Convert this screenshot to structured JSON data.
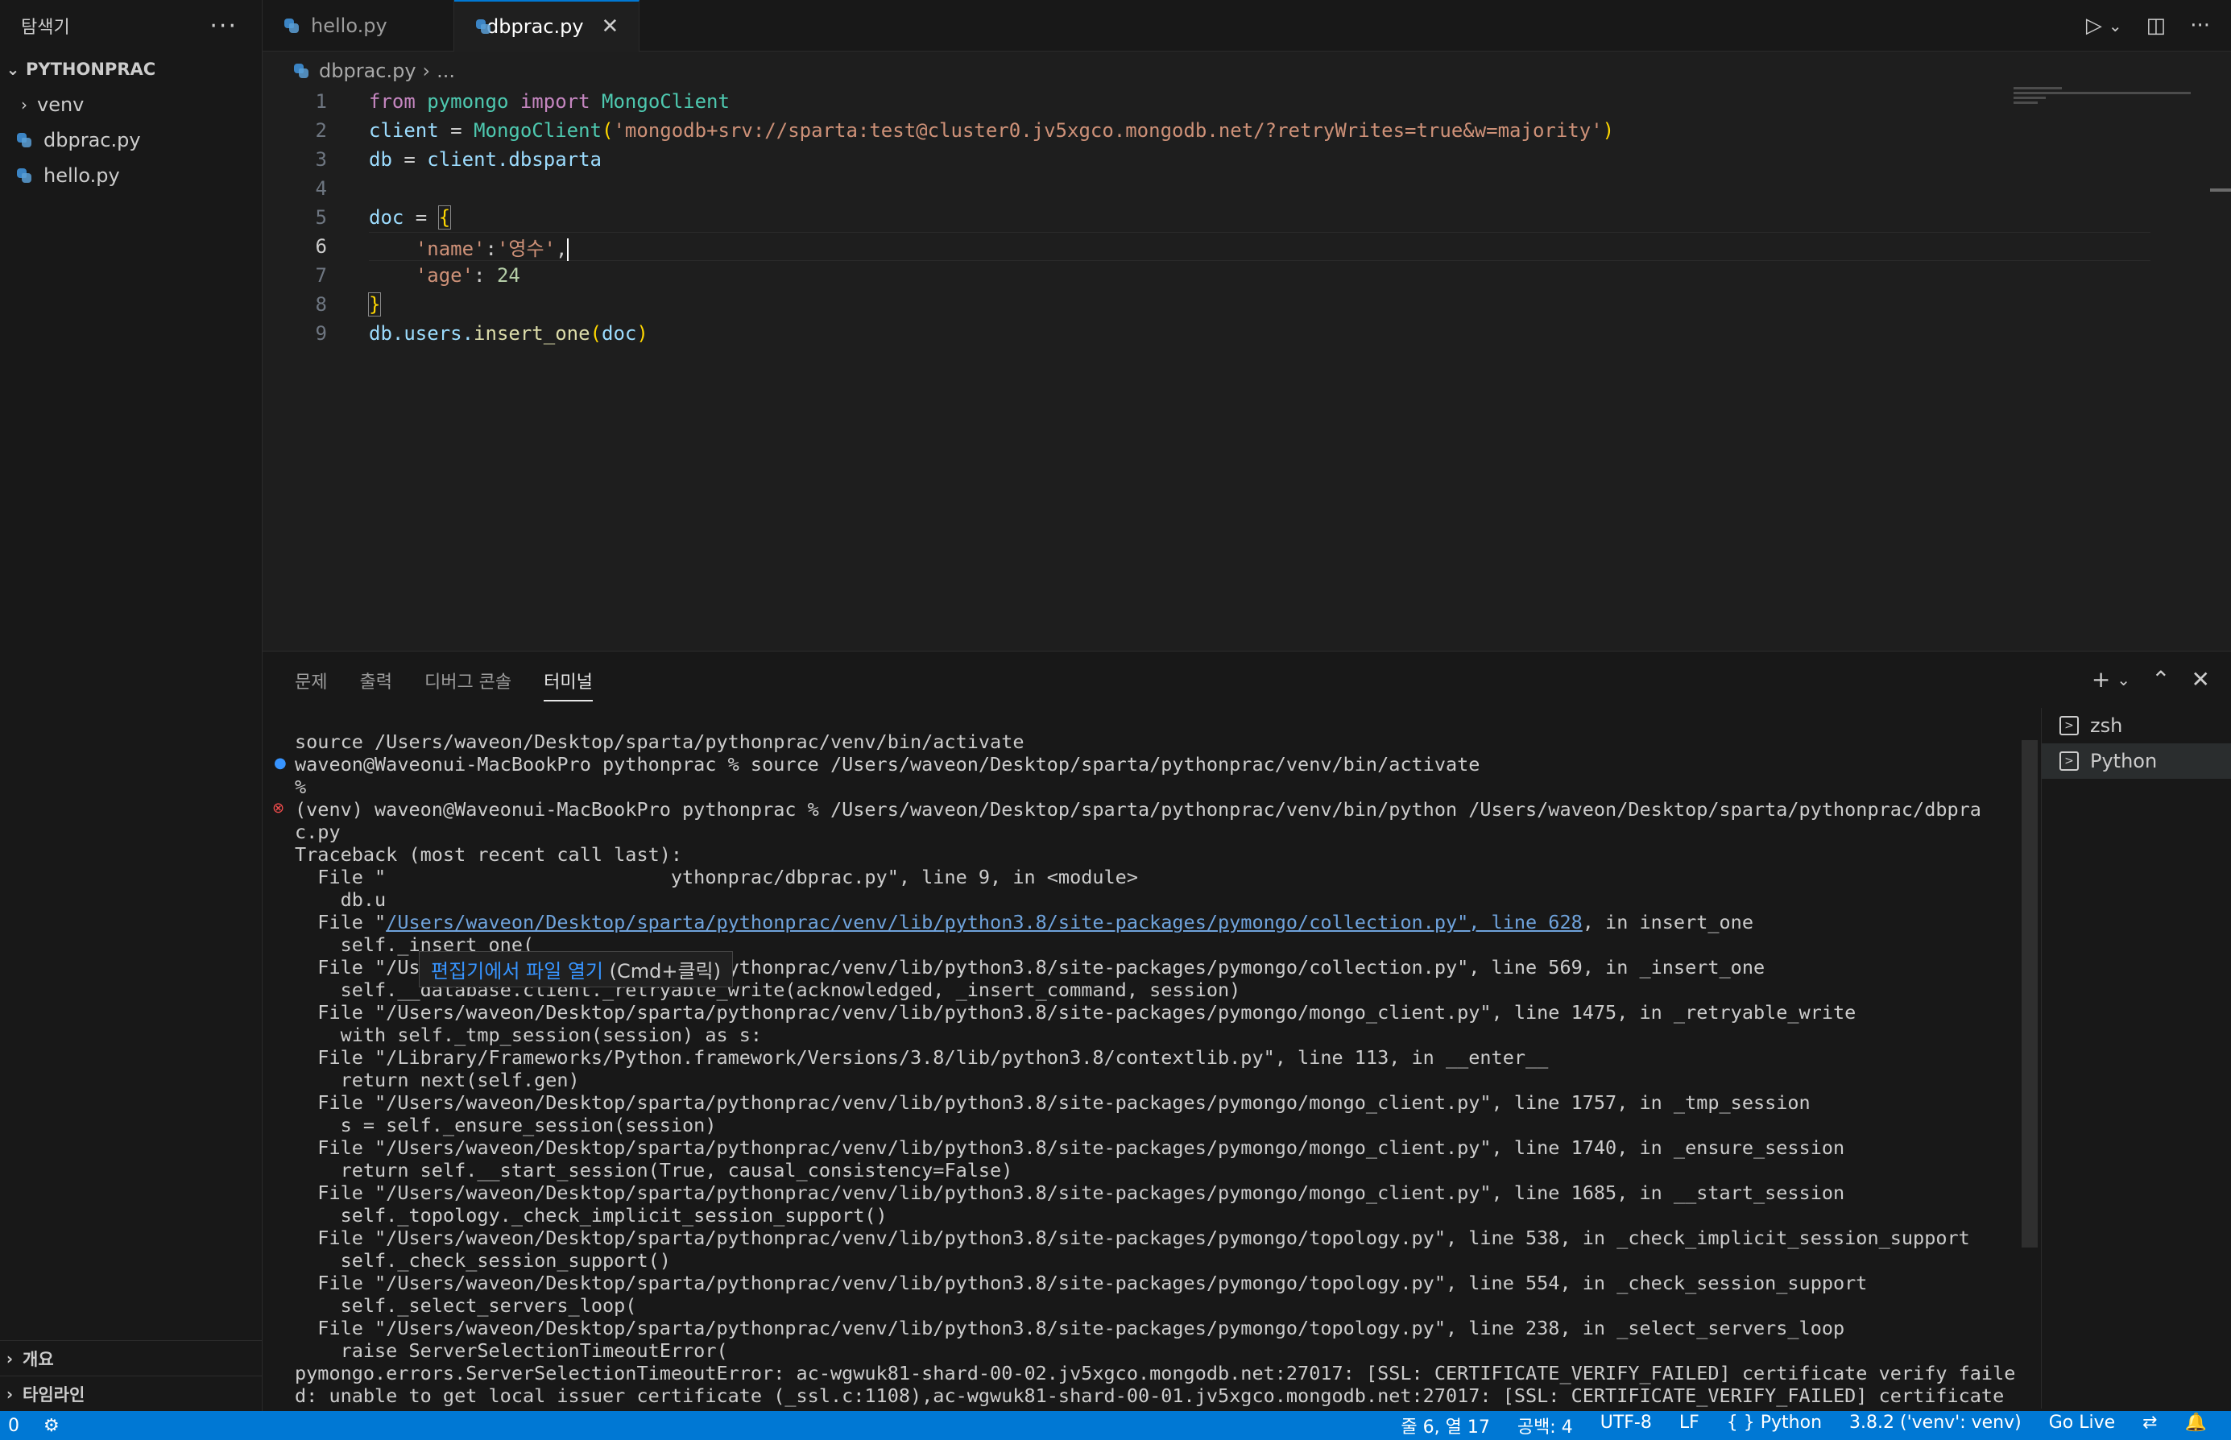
{
  "sidebar": {
    "title": "탐색기",
    "more": "···",
    "project": "PYTHONPRAC",
    "items": [
      {
        "label": "venv",
        "type": "folder"
      },
      {
        "label": "dbprac.py",
        "type": "file"
      },
      {
        "label": "hello.py",
        "type": "file"
      }
    ],
    "outline": "개요",
    "timeline": "타임라인"
  },
  "tabs": [
    {
      "label": "hello.py"
    },
    {
      "label": "dbprac.py",
      "close": "✕"
    }
  ],
  "tab_actions": {
    "run": "▷",
    "run_menu": "⌄",
    "split": "◫",
    "more": "···"
  },
  "breadcrumb": {
    "file": "dbprac.py",
    "sep": "›",
    "more": "..."
  },
  "editor": {
    "lines": [
      {
        "n": "1"
      },
      {
        "n": "2"
      },
      {
        "n": "3"
      },
      {
        "n": "4"
      },
      {
        "n": "5"
      },
      {
        "n": "6"
      },
      {
        "n": "7"
      },
      {
        "n": "8"
      },
      {
        "n": "9"
      }
    ],
    "code": {
      "l1_from": "from",
      "l1_mod": "pymongo",
      "l1_import": "import",
      "l1_cls": "MongoClient",
      "l2_var": "client",
      "l2_eq": " = ",
      "l2_cls": "MongoClient",
      "l2_open": "(",
      "l2_str": "'mongodb+srv://sparta:test@cluster0.jv5xgco.mongodb.net/?retryWrites=true&w=majority'",
      "l2_close": ")",
      "l3_var": "db",
      "l3_eq": " = ",
      "l3_rest": "client.dbsparta",
      "l5_var": "doc",
      "l5_eq": " = ",
      "l5_brace": "{",
      "l6_key": "'name'",
      "l6_colon": ":",
      "l6_val": "'영수'",
      "l6_comma": ",",
      "l7_key": "'age'",
      "l7_colon": ": ",
      "l7_val": "24",
      "l8_brace": "}",
      "l9_obj": "db.users.",
      "l9_fn": "insert_one",
      "l9_open": "(",
      "l9_arg": "doc",
      "l9_close": ")"
    }
  },
  "panel": {
    "tabs": [
      "문제",
      "출력",
      "디버그 콘솔",
      "터미널"
    ],
    "actions": {
      "add": "+",
      "add_menu": "⌄",
      "maximize": "⌃",
      "close": "✕"
    },
    "terminals": [
      {
        "label": "zsh",
        "icon": ">"
      },
      {
        "label": "Python",
        "icon": ">"
      }
    ],
    "tooltip": {
      "link": "편집기에서 파일 열기",
      "hint": " (Cmd+클릭)"
    },
    "lines": [
      "source /Users/waveon/Desktop/sparta/pythonprac/venv/bin/activate",
      "waveon@Waveonui-MacBookPro pythonprac % source /Users/waveon/Desktop/sparta/pythonprac/venv/bin/activate",
      "%",
      "(venv) waveon@Waveonui-MacBookPro pythonprac % /Users/waveon/Desktop/sparta/pythonprac/venv/bin/python /Users/waveon/Desktop/sparta/pythonprac/dbpra",
      "c.py",
      "Traceback (most recent call last):",
      "  File \"                         ythonprac/dbprac.py\", line 9, in <module>",
      "    db.u",
      "  File \"/Users/waveon/Desktop/sparta/pythonprac/venv/lib/python3.8/site-packages/pymongo/collection.py\", line 628, in insert_one",
      "    self._insert_one(",
      "  File \"/Users/waveon/Desktop/sparta/pythonprac/venv/lib/python3.8/site-packages/pymongo/collection.py\", line 569, in _insert_one",
      "    self.__database.client._retryable_write(acknowledged, _insert_command, session)",
      "  File \"/Users/waveon/Desktop/sparta/pythonprac/venv/lib/python3.8/site-packages/pymongo/mongo_client.py\", line 1475, in _retryable_write",
      "    with self._tmp_session(session) as s:",
      "  File \"/Library/Frameworks/Python.framework/Versions/3.8/lib/python3.8/contextlib.py\", line 113, in __enter__",
      "    return next(self.gen)",
      "  File \"/Users/waveon/Desktop/sparta/pythonprac/venv/lib/python3.8/site-packages/pymongo/mongo_client.py\", line 1757, in _tmp_session",
      "    s = self._ensure_session(session)",
      "  File \"/Users/waveon/Desktop/sparta/pythonprac/venv/lib/python3.8/site-packages/pymongo/mongo_client.py\", line 1740, in _ensure_session",
      "    return self.__start_session(True, causal_consistency=False)",
      "  File \"/Users/waveon/Desktop/sparta/pythonprac/venv/lib/python3.8/site-packages/pymongo/mongo_client.py\", line 1685, in __start_session",
      "    self._topology._check_implicit_session_support()",
      "  File \"/Users/waveon/Desktop/sparta/pythonprac/venv/lib/python3.8/site-packages/pymongo/topology.py\", line 538, in _check_implicit_session_support",
      "    self._check_session_support()",
      "  File \"/Users/waveon/Desktop/sparta/pythonprac/venv/lib/python3.8/site-packages/pymongo/topology.py\", line 554, in _check_session_support",
      "    self._select_servers_loop(",
      "  File \"/Users/waveon/Desktop/sparta/pythonprac/venv/lib/python3.8/site-packages/pymongo/topology.py\", line 238, in _select_servers_loop",
      "    raise ServerSelectionTimeoutError(",
      "pymongo.errors.ServerSelectionTimeoutError: ac-wgwuk81-shard-00-02.jv5xgco.mongodb.net:27017: [SSL: CERTIFICATE_VERIFY_FAILED] certificate verify faile",
      "d: unable to get local issuer certificate (_ssl.c:1108),ac-wgwuk81-shard-00-01.jv5xgco.mongodb.net:27017: [SSL: CERTIFICATE_VERIFY_FAILED] certificate"
    ],
    "link_line": {
      "prefix": "  File \"",
      "link": "/Users/waveon/Desktop/sparta/pythonprac/venv/lib/python3.8/site-packages/pymongo/collection.py\", line 628",
      "suffix": ", in insert_one"
    }
  },
  "statusbar": {
    "left": [
      "0",
      "⚙"
    ],
    "right": [
      "줄 6, 열 17",
      "공백: 4",
      "UTF-8",
      "LF",
      "{ } Python",
      "3.8.2 ('venv': venv)",
      "Go Live",
      "⇄",
      "🔔"
    ]
  },
  "colors": {
    "accent": "#0078d4",
    "keyword": "#c586c0",
    "class": "#4ec9b0",
    "string": "#ce9178",
    "number": "#b5cea8",
    "function": "#dcdcaa",
    "variable": "#9cdcfe",
    "bracket": "#ffd700"
  }
}
